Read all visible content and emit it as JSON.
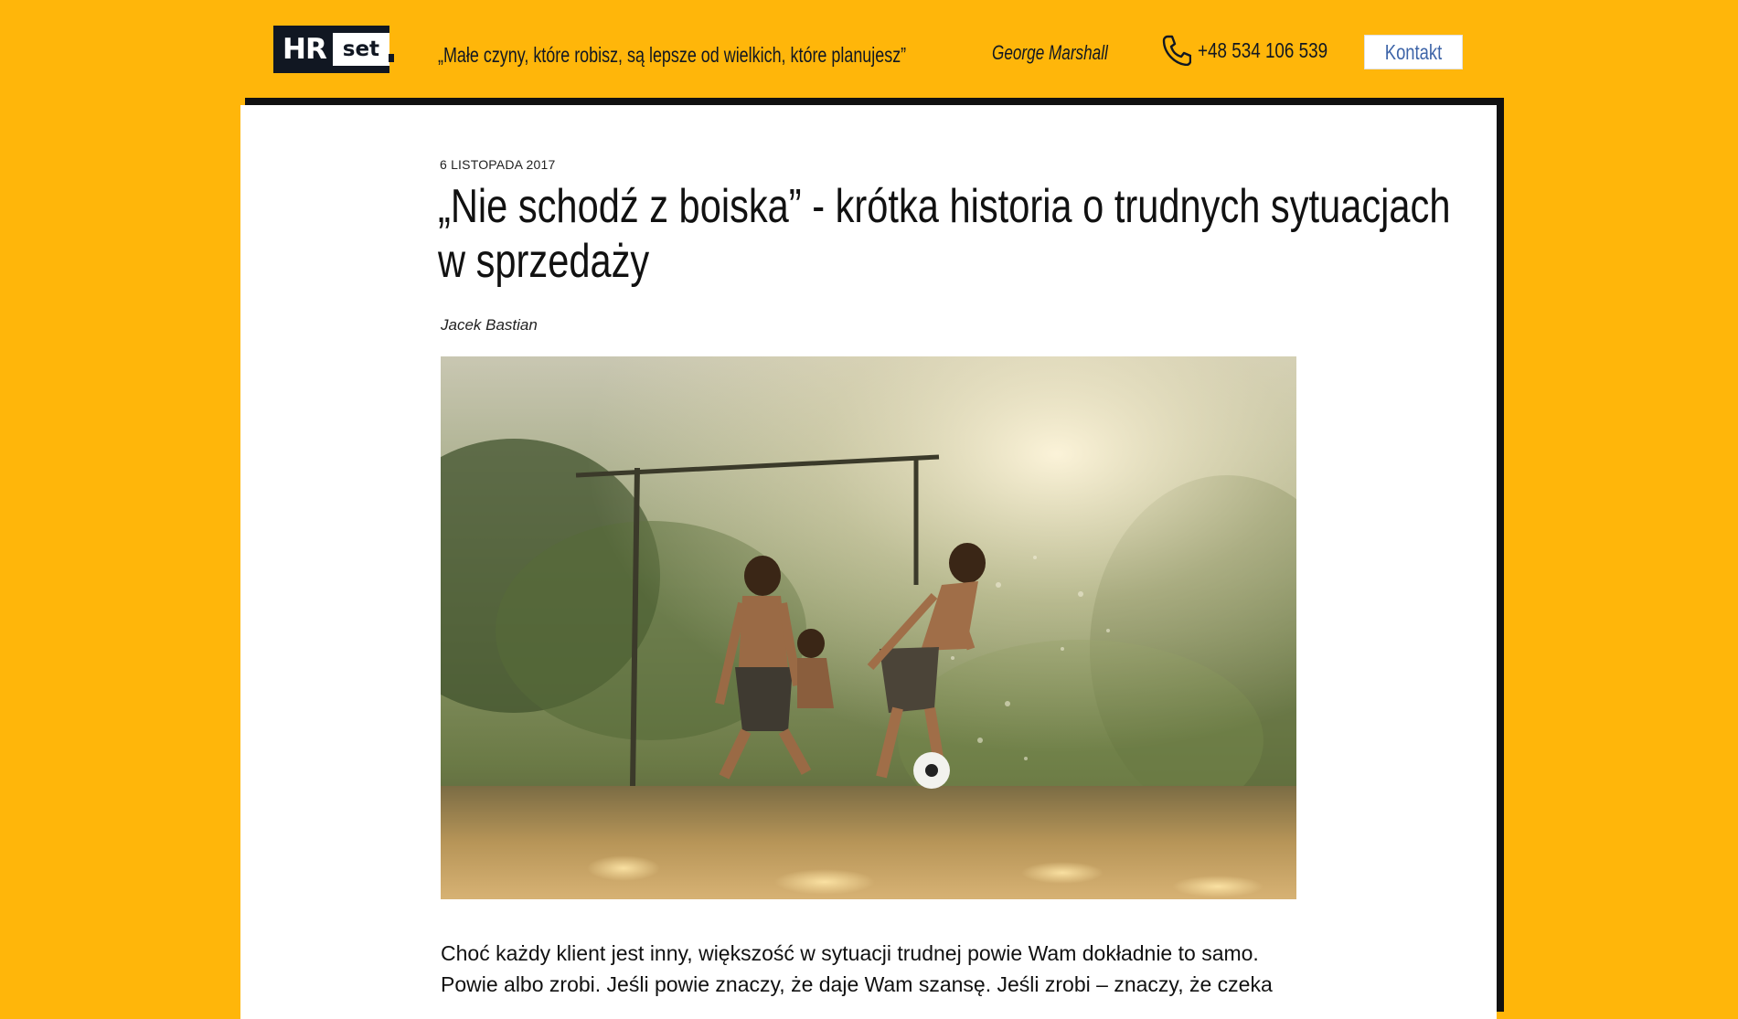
{
  "header": {
    "logo_hr": "HR",
    "logo_set": "set",
    "quote": "„Małe czyny, które robisz, są lepsze od wielkich, które planujesz”",
    "quote_author": "George Marshall",
    "phone_icon": "phone-icon",
    "phone": "+48 534 106 539",
    "contact_label": "Kontakt"
  },
  "post": {
    "date": "6 listopada 2017",
    "title": "„Nie schodź z boiska” - krótka historia o trudnych sytuacjach w sprzedaży",
    "author": "Jacek Bastian",
    "body": "Choć każdy klient jest inny, większość w sytuacji trudnej powie Wam dokładnie to samo. Powie albo zrobi. Jeśli powie znaczy, że daje Wam szansę. Jeśli zrobi – znaczy, że czeka"
  },
  "colors": {
    "page_background": "#FFB60A",
    "logo_dark": "#111722",
    "contact_text": "#3D64A8",
    "card": "#FFFFFF",
    "text": "#111111"
  }
}
